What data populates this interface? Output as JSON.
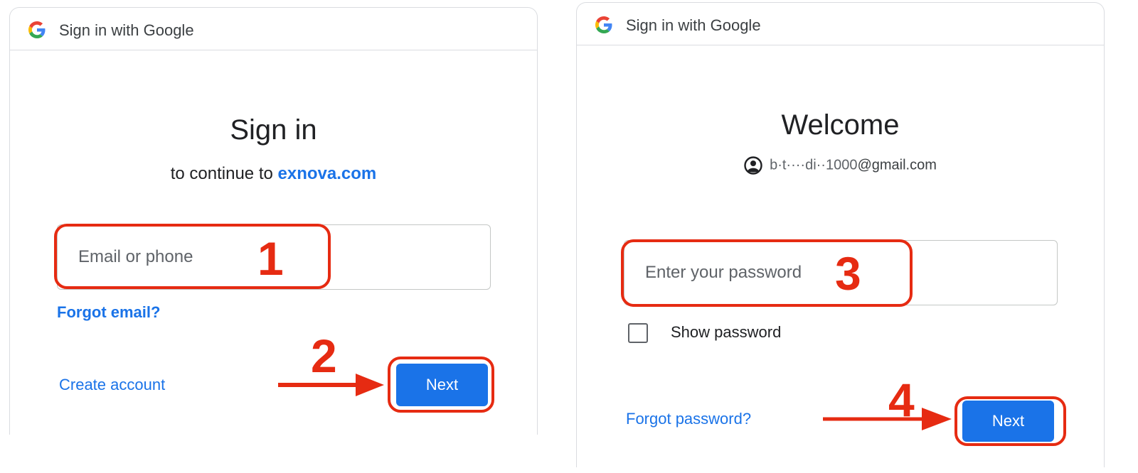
{
  "header_title": "Sign in with Google",
  "step1": {
    "title": "Sign in",
    "subtitle_prefix": "to continue to",
    "subtitle_link": "exnova.com",
    "email_placeholder": "Email or phone",
    "forgot_email": "Forgot email?",
    "create_account": "Create account",
    "next": "Next"
  },
  "step2": {
    "title": "Welcome",
    "email_masked_prefix": "b·t····di··1000",
    "email_suffix": "@gmail.com",
    "password_placeholder": "Enter your password",
    "show_password": "Show password",
    "forgot_password": "Forgot password?",
    "next": "Next"
  },
  "annotations": {
    "n1": "1",
    "n2": "2",
    "n3": "3",
    "n4": "4"
  },
  "colors": {
    "accent": "#1a73e8",
    "annotation": "#e62b12",
    "border": "#dadce0"
  }
}
